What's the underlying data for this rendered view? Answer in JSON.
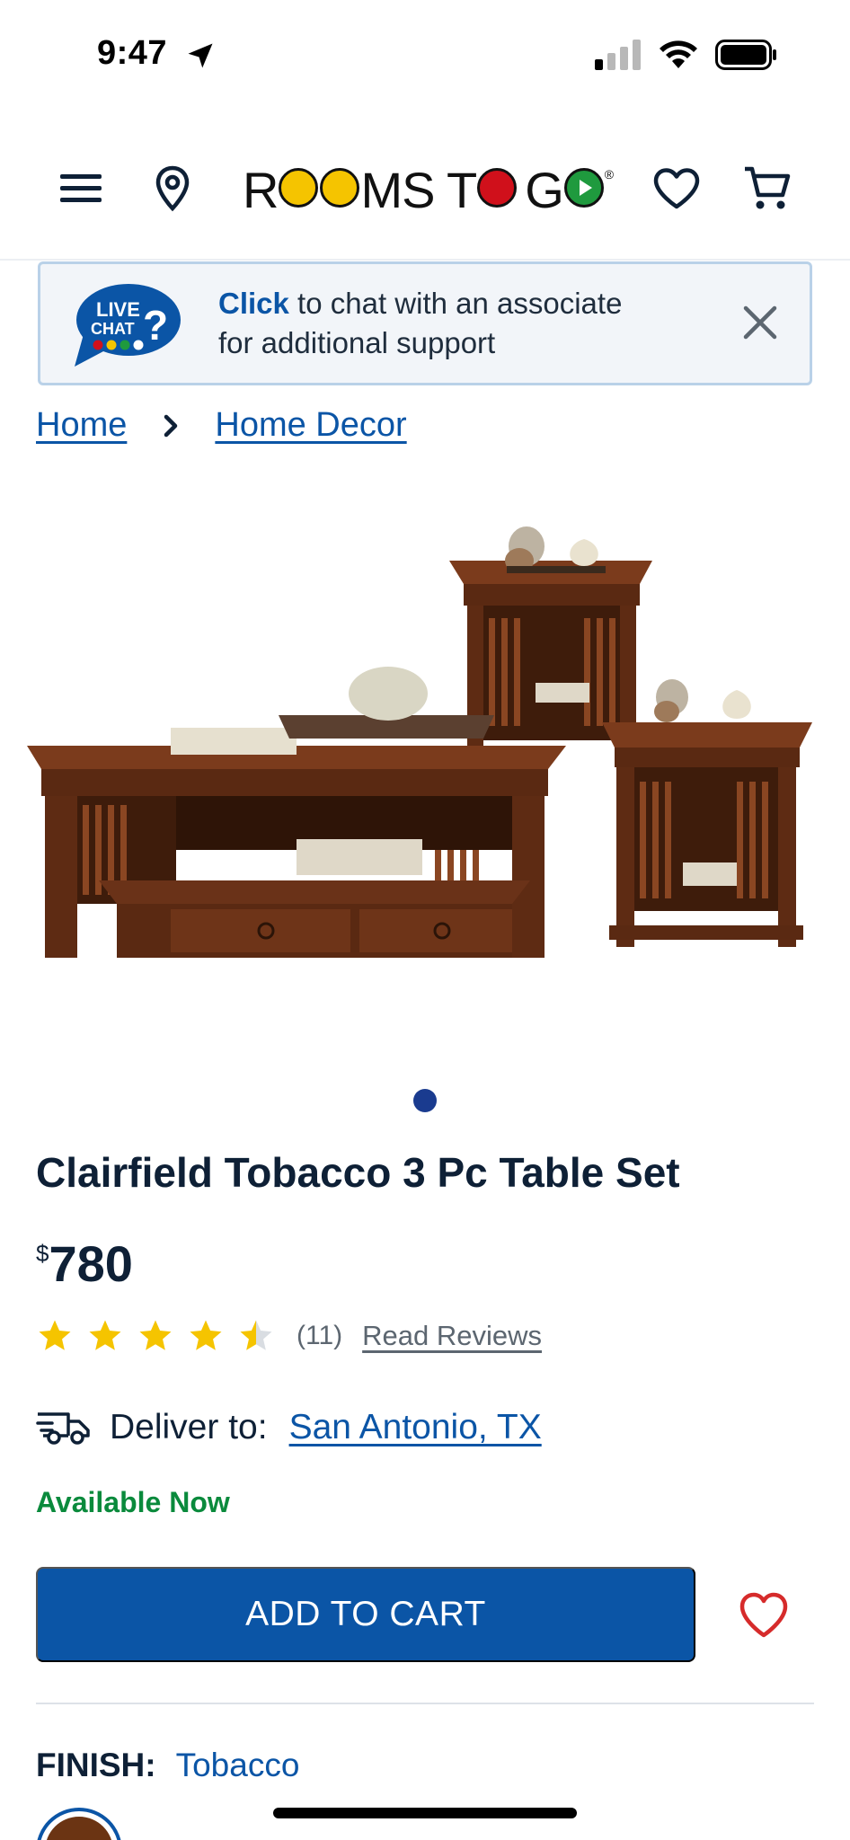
{
  "status_bar": {
    "time": "9:47"
  },
  "header": {
    "logo_text": "ROOMS TO GO",
    "logo_colors": [
      "#f5c400",
      "#f5c400",
      "#d0101b",
      "#1f9a3e"
    ]
  },
  "chat_banner": {
    "bubble_line1": "LIVE",
    "bubble_line2": "CHAT",
    "bubble_mark": "?",
    "link_text": "Click",
    "text_rest": " to chat with an associate",
    "text_line2": "for additional support"
  },
  "breadcrumb": [
    "Home",
    "Home Decor"
  ],
  "product": {
    "title": "Clairfield Tobacco 3 Pc Table Set",
    "currency": "$",
    "price": "780",
    "rating": 4.5,
    "review_count": "(11)",
    "read_reviews_label": "Read Reviews",
    "deliver_label": "Deliver to:",
    "deliver_city": "San Antonio, TX",
    "availability": "Available Now",
    "add_to_cart_label": "ADD TO CART",
    "finish_label": "FINISH:",
    "finish_value": "Tobacco"
  },
  "colors": {
    "brand_blue": "#0b55a6",
    "available_green": "#0a8a3c",
    "star_gold": "#f5c400",
    "favorite_red": "#d62b2b"
  }
}
